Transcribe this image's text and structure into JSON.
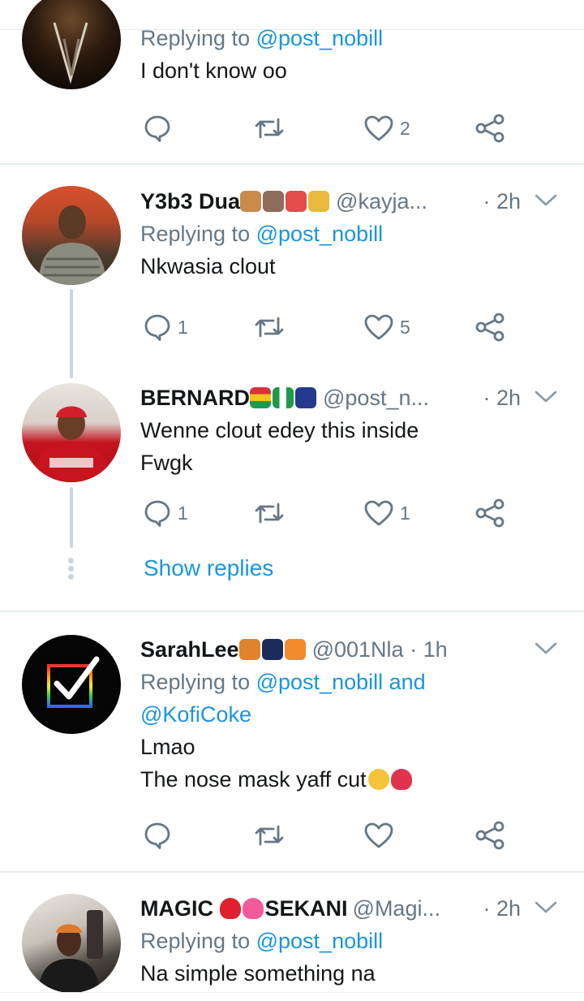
{
  "tweets": [
    {
      "reply_prefix": "Replying to",
      "reply_mention": "@post_nobill",
      "text": "I don't know oo",
      "likes": "2"
    },
    {
      "name": "Y3b3 Dua",
      "emojis": [
        "#c98a4a",
        "#8e6b5a",
        "#e34a4a",
        "#e8b93a"
      ],
      "handle": "@kayja...",
      "time": "· 2h",
      "reply_prefix": "Replying to",
      "reply_mention": "@post_nobill",
      "text": "Nkwasia clout",
      "replies": "1",
      "likes": "5"
    },
    {
      "name": "BERNARD",
      "emojis": [
        "#d9313a",
        "#1f9a4a",
        "#233a8f"
      ],
      "handle": "@post_n...",
      "time": "· 2h",
      "text_line1": "Wenne clout edey this inside",
      "text_line2": "Fwgk",
      "replies": "1",
      "likes": "1",
      "show_replies": "Show replies"
    },
    {
      "name": "SarahLee",
      "emojis": [
        "#e0842c",
        "#1c2c5a",
        "#f28b2c"
      ],
      "handle": "@001Nla",
      "time": "· 1h",
      "reply_prefix": "Replying to",
      "reply_mention": "@post_nobill and",
      "reply_mention2": "@KofiCoke",
      "text_line1": "Lmao",
      "text_line2": "The nose mask yaff cut"
    },
    {
      "name": "MAGIC",
      "name2": "SEKANI",
      "handle": "@Magi...",
      "time": "· 2h",
      "reply_prefix": "Replying to",
      "reply_mention": "@post_nobill",
      "text": "Na simple something na"
    }
  ],
  "colors": {
    "link": "#1b95e0",
    "secondary": "#657786",
    "divider": "#e6ecf0",
    "thread": "#ccd6dd"
  }
}
